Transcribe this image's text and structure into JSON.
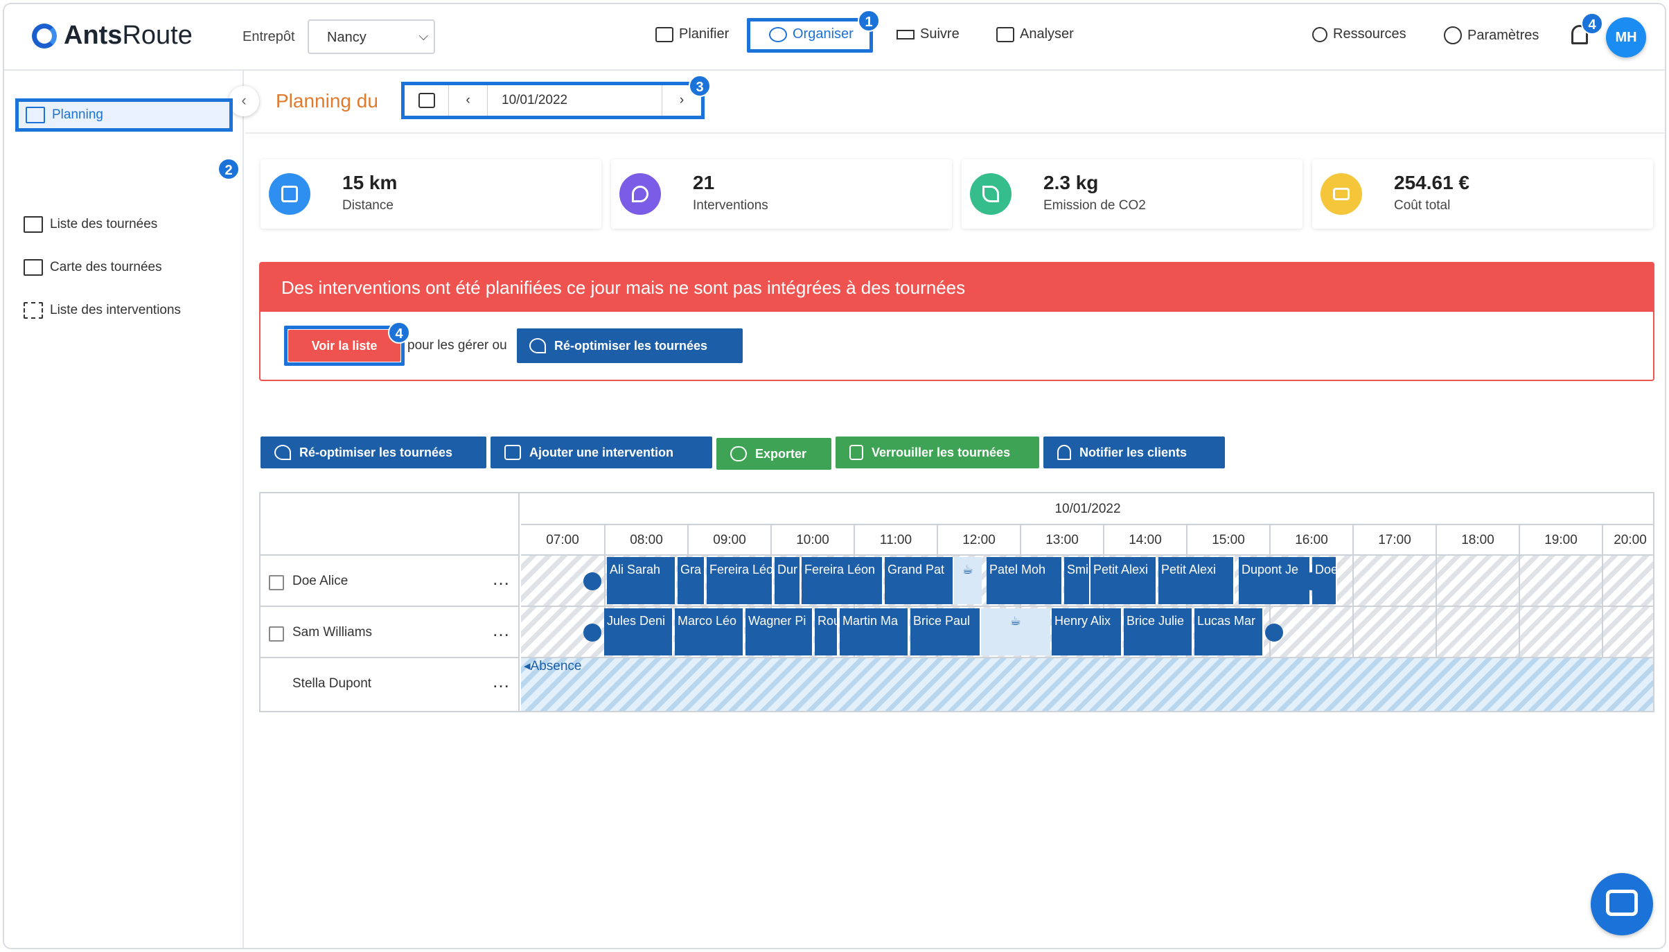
{
  "header": {
    "logo_part1": "Ants",
    "logo_part2": "Route",
    "warehouse_label": "Entrepôt",
    "warehouse_value": "Nancy",
    "nav": [
      "Planifier",
      "Organiser",
      "Suivre",
      "Analyser"
    ],
    "resources": "Ressources",
    "settings": "Paramètres",
    "notif_count": "4",
    "avatar": "MH"
  },
  "callouts": [
    "1",
    "2",
    "3",
    "4"
  ],
  "sidebar": {
    "items": [
      "Planning",
      "Liste des tournées",
      "Carte des tournées",
      "Liste des interventions"
    ]
  },
  "planning": {
    "title": "Planning du",
    "date": "10/01/2022"
  },
  "stats": [
    {
      "value": "15 km",
      "label": "Distance",
      "color": "#2f8ff0"
    },
    {
      "value": "21",
      "label": "Interventions",
      "color": "#7b5ce6"
    },
    {
      "value": "2.3 kg",
      "label": "Emission de CO2",
      "color": "#35bd8c"
    },
    {
      "value": "254.61 €",
      "label": "Coût total",
      "color": "#f5c53a"
    }
  ],
  "alert": {
    "message": "Des interventions ont été planifiées ce jour mais ne sont pas intégrées à des tournées",
    "see_list": "Voir la liste",
    "middle_text": "pour les gérer ou",
    "reoptimize": "Ré-optimiser les tournées"
  },
  "toolbar": [
    "Ré-optimiser les tournées",
    "Ajouter une intervention",
    "Exporter",
    "Verrouiller les tournées",
    "Notifier les clients"
  ],
  "gantt": {
    "date": "10/01/2022",
    "hours": [
      "07:00",
      "08:00",
      "09:00",
      "10:00",
      "11:00",
      "12:00",
      "13:00",
      "14:00",
      "15:00",
      "16:00",
      "17:00",
      "18:00",
      "19:00",
      "20:00"
    ],
    "resources": [
      "Doe Alice",
      "Sam Williams",
      "Stella Dupont"
    ],
    "row1": [
      "Ali Sarah",
      "Gra",
      "Fereira Léo",
      "Dur",
      "Fereira Léon",
      "Grand Pat",
      "Patel Moh",
      "Smi",
      "Petit Alexi",
      "Petit Alexi",
      "Dupont Je",
      "Doe"
    ],
    "row2": [
      "Jules Deni",
      "Marco Léo",
      "Wagner Pi",
      "Rou",
      "Martin Ma",
      "Brice Paul",
      "Henry Alix",
      "Brice Julie",
      "Lucas Mar"
    ],
    "absence": "Absence"
  }
}
